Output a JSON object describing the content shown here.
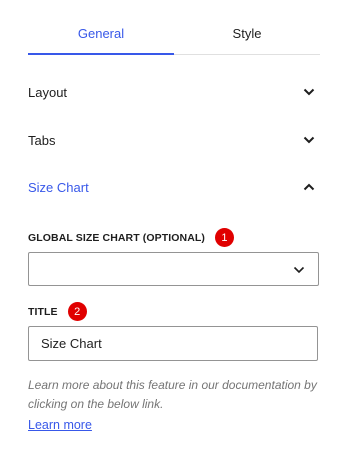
{
  "tabs": [
    {
      "label": "General",
      "active": true
    },
    {
      "label": "Style",
      "active": false
    }
  ],
  "sections": [
    {
      "label": "Layout",
      "state": "collapsed",
      "icon": "chevron-down-icon"
    },
    {
      "label": "Tabs",
      "state": "collapsed",
      "icon": "chevron-down-icon"
    },
    {
      "label": "Size Chart",
      "state": "expanded",
      "icon": "chevron-up-icon"
    }
  ],
  "size_chart": {
    "global_label": "GLOBAL SIZE CHART (OPTIONAL)",
    "global_badge": "1",
    "global_value": "",
    "global_icon": "chevron-down-icon",
    "title_label": "TITLE",
    "title_badge": "2",
    "title_value": "Size Chart",
    "help_text": "Learn more about this feature in our documentation by clicking on the below link.",
    "link_text": "Learn more"
  },
  "colors": {
    "accent": "#3858e9",
    "badge": "#e00000",
    "text": "#1e1e1e",
    "muted": "#757575",
    "border": "#949494"
  }
}
